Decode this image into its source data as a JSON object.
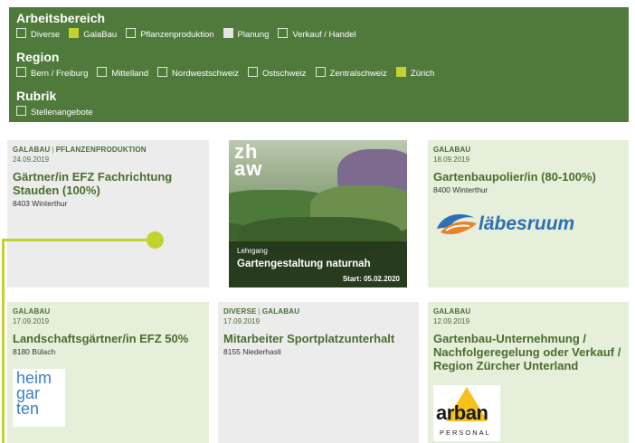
{
  "filters": {
    "arbeitsbereich": {
      "title": "Arbeitsbereich",
      "options": [
        {
          "label": "Diverse",
          "state": "unchecked"
        },
        {
          "label": "GalaBau",
          "state": "checked"
        },
        {
          "label": "Pflanzenproduktion",
          "state": "unchecked"
        },
        {
          "label": "Planung",
          "state": "grey"
        },
        {
          "label": "Verkauf / Handel",
          "state": "unchecked"
        }
      ]
    },
    "region": {
      "title": "Region",
      "options": [
        {
          "label": "Bern / Freiburg",
          "state": "unchecked"
        },
        {
          "label": "Mittelland",
          "state": "unchecked"
        },
        {
          "label": "Nordwestschweiz",
          "state": "unchecked"
        },
        {
          "label": "Ostschweiz",
          "state": "unchecked"
        },
        {
          "label": "Zentralschweiz",
          "state": "unchecked"
        },
        {
          "label": "Zürich",
          "state": "checked"
        }
      ]
    },
    "rubrik": {
      "title": "Rubrik",
      "options": [
        {
          "label": "Stellenangebote",
          "state": "unchecked"
        }
      ]
    }
  },
  "cards": {
    "c1": {
      "cat1": "GALABAU",
      "sep": "|",
      "cat2": "PFLANZENPRODUKTION",
      "date": "24.09.2019",
      "title": "Gärtner/in EFZ Fachrichtung Stauden (100%)",
      "location": "8403 Winterthur"
    },
    "c2": {
      "cat1": "GALABAU",
      "date": "18.09.2019",
      "title": "Gartenbaupolier/in (80-100%)",
      "location": "8400 Winterthur",
      "logo_text": "läbesruum"
    },
    "c3": {
      "cat1": "GALABAU",
      "date": "17.09.2019",
      "title": "Landschaftsgärtner/in EFZ 50%",
      "location": "8180 Bülach",
      "logo_lines": [
        "heim",
        "gar",
        "ten"
      ]
    },
    "c4": {
      "cat1": "DIVERSE",
      "sep": "|",
      "cat2": "GALABAU",
      "date": "17.09.2019",
      "title": "Mitarbeiter Sportplatzunterhalt",
      "location": "8155 Niederhasli"
    },
    "c5": {
      "cat1": "GALABAU",
      "date": "12.09.2019",
      "title": "Gartenbau-Unternehmung / Nachfolgeregelung oder Verkauf / Region Zürcher Unterland",
      "logo_text": "arban",
      "logo_sub": "PERSONAL"
    }
  },
  "ad": {
    "brand_line1": "zh",
    "brand_line2": "aw",
    "kicker": "Lehrgang",
    "course": "Gartengestaltung naturnah",
    "start": "Start: 05.02.2020"
  },
  "colors": {
    "filter_bg": "#4f7a3b",
    "accent": "#c4d22f",
    "card_green": "#e5efd9",
    "card_grey": "#ececec",
    "title_green": "#4a6d2f"
  }
}
